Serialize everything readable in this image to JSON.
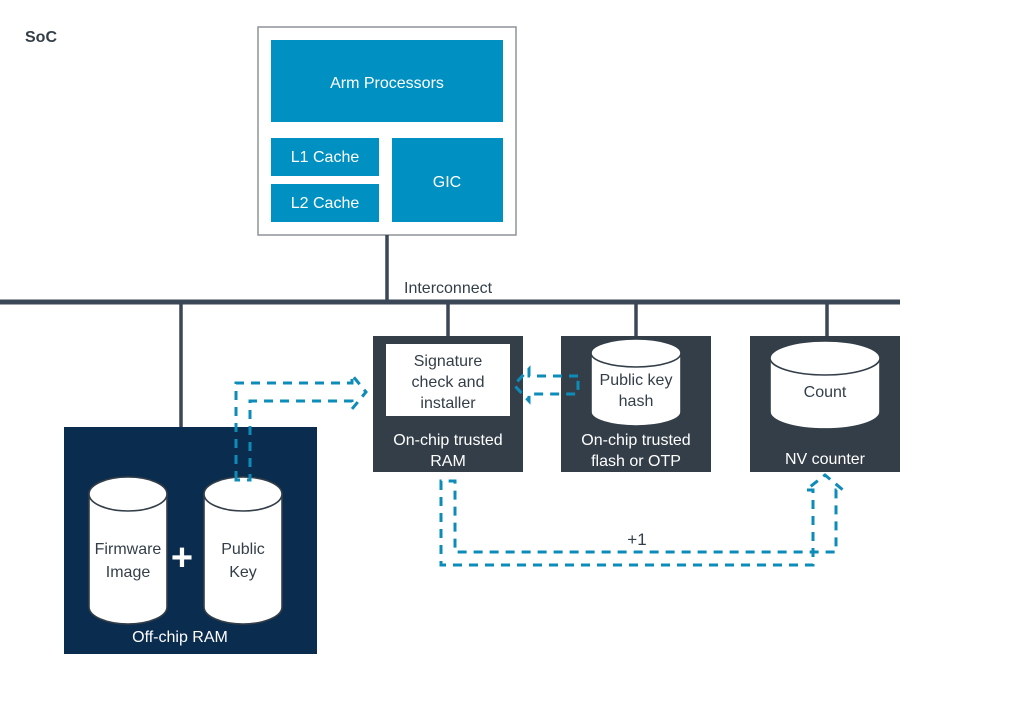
{
  "diagram": {
    "title": "SoC",
    "bus_label": "Interconnect",
    "colors": {
      "arm_blue": "#0091c2",
      "navy": "#0a2c4e",
      "slate": "#333e48",
      "bus": "#3b4756",
      "arrow_teal": "#0d8cba",
      "white": "#ffffff"
    },
    "soc_block": {
      "processors": "Arm Processors",
      "l1_cache": "L1 Cache",
      "l2_cache": "L2 Cache",
      "gic": "GIC"
    },
    "offchip_ram": {
      "caption": "Off-chip RAM",
      "firmware_line1": "Firmware",
      "firmware_line2": "Image",
      "operator": "+",
      "publickey_line1": "Public",
      "publickey_line2": "Key"
    },
    "trusted_ram": {
      "inner_line1": "Signature",
      "inner_line2": "check and",
      "inner_line3": "installer",
      "caption_line1": "On-chip trusted",
      "caption_line2": "RAM"
    },
    "trusted_flash": {
      "cylinder_line1": "Public key",
      "cylinder_line2": "hash",
      "caption_line1": "On-chip trusted",
      "caption_line2": "flash or OTP"
    },
    "nv_counter": {
      "cylinder_label": "Count",
      "caption": "NV counter"
    },
    "flows": {
      "increment_label": "+1"
    }
  }
}
